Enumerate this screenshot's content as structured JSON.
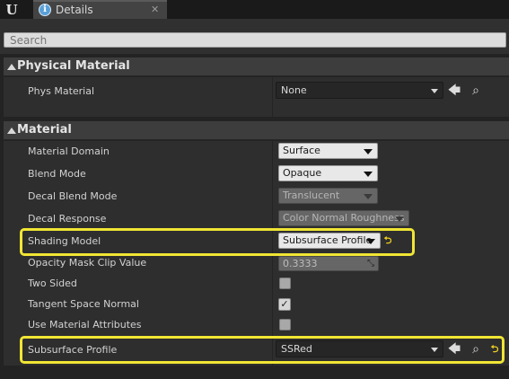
{
  "tab": {
    "title": "Details",
    "close": "✕",
    "info": "i"
  },
  "logo": "U",
  "search": {
    "placeholder": "Search"
  },
  "physical_section": {
    "title": "Physical Material",
    "rows": [
      {
        "label": "Phys Material",
        "value": "None"
      }
    ]
  },
  "material_section": {
    "title": "Material",
    "rows": {
      "material_domain": {
        "label": "Material Domain",
        "value": "Surface"
      },
      "blend_mode": {
        "label": "Blend Mode",
        "value": "Opaque"
      },
      "decal_blend_mode": {
        "label": "Decal Blend Mode",
        "value": "Translucent"
      },
      "decal_response": {
        "label": "Decal Response",
        "value": "Color Normal Roughness"
      },
      "shading_model": {
        "label": "Shading Model",
        "value": "Subsurface Profile"
      },
      "opacity_mask_clip": {
        "label": "Opacity Mask Clip Value",
        "value": "0.3333"
      },
      "two_sided": {
        "label": "Two Sided",
        "checked": false
      },
      "tangent_space_normal": {
        "label": "Tangent Space Normal",
        "checked": true
      },
      "use_material_attributes": {
        "label": "Use Material Attributes",
        "checked": false
      },
      "subsurface_profile": {
        "label": "Subsurface Profile",
        "value": "SSRed"
      }
    }
  },
  "icons": {
    "use_selected": "🡄",
    "browse": "⌕",
    "reset": "⮌",
    "check": "✓",
    "resize": "⤡"
  },
  "colors": {
    "highlight": "#f0e534",
    "background": "#2e2e2e",
    "header": "#3d3d3d"
  }
}
